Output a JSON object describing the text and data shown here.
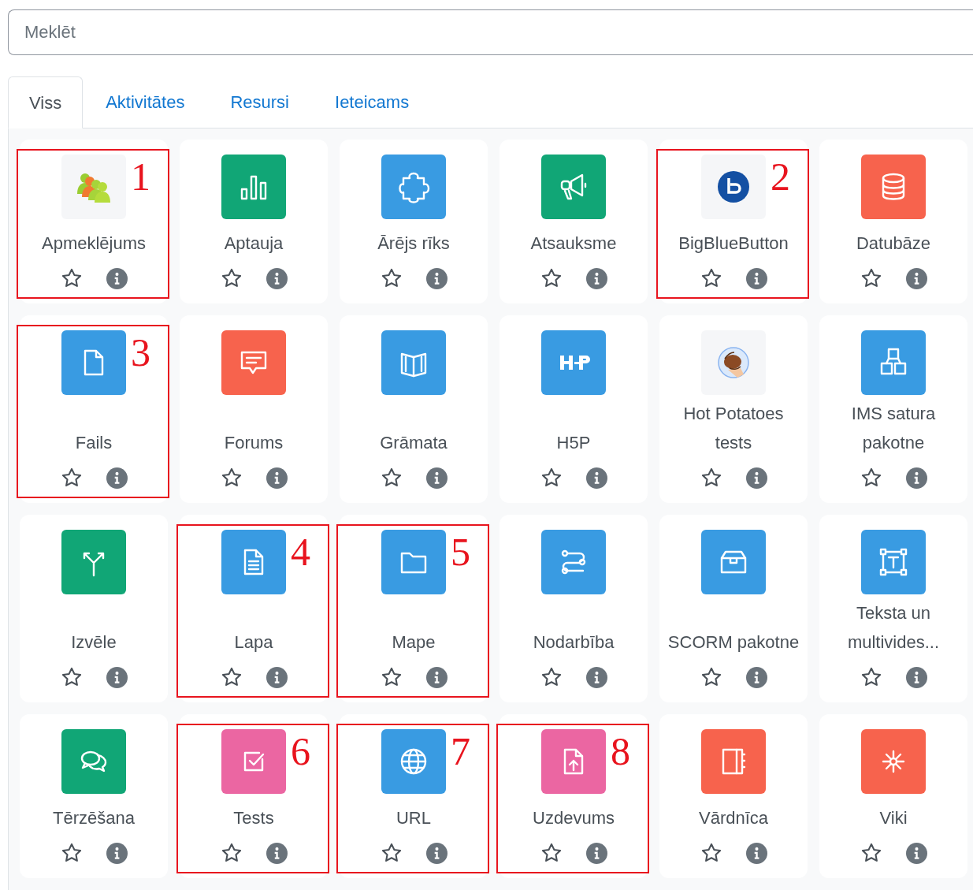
{
  "search": {
    "placeholder": "Meklēt"
  },
  "tabs": [
    {
      "label": "Viss",
      "selected": true
    },
    {
      "label": "Aktivitātes",
      "selected": false
    },
    {
      "label": "Resursi",
      "selected": false
    },
    {
      "label": "Ieteicams",
      "selected": false
    }
  ],
  "modules": [
    {
      "label": "Apmeklējums",
      "kind": "attendance",
      "color": "#f5f6f8",
      "callout": "1"
    },
    {
      "label": "Aptauja",
      "kind": "chart",
      "color": "#11a676"
    },
    {
      "label": "Ārējs rīks",
      "kind": "puzzle",
      "color": "#399be2"
    },
    {
      "label": "Atsauksme",
      "kind": "megaphone",
      "color": "#11a676"
    },
    {
      "label": "BigBlueButton",
      "kind": "bbb",
      "color": "#f5f6f8",
      "callout": "2"
    },
    {
      "label": "Datubāze",
      "kind": "database",
      "color": "#f7634d"
    },
    {
      "label": "Fails",
      "kind": "file",
      "color": "#399be2",
      "callout": "3"
    },
    {
      "label": "Forums",
      "kind": "forum",
      "color": "#f7634d"
    },
    {
      "label": "Grāmata",
      "kind": "book",
      "color": "#399be2"
    },
    {
      "label": "H5P",
      "kind": "h5p",
      "color": "#399be2"
    },
    {
      "label": "Hot Potatoes tests",
      "kind": "hotpot",
      "color": "#f5f6f8"
    },
    {
      "label": "IMS satura pakotne",
      "kind": "boxes",
      "color": "#399be2"
    },
    {
      "label": "Izvēle",
      "kind": "choice",
      "color": "#11a676"
    },
    {
      "label": "Lapa",
      "kind": "page",
      "color": "#399be2",
      "callout": "4"
    },
    {
      "label": "Mape",
      "kind": "folder",
      "color": "#399be2",
      "callout": "5"
    },
    {
      "label": "Nodarbība",
      "kind": "workshop",
      "color": "#399be2"
    },
    {
      "label": "SCORM pakotne",
      "kind": "scorm",
      "color": "#399be2"
    },
    {
      "label": "Teksta un multivides...",
      "kind": "textframe",
      "color": "#399be2"
    },
    {
      "label": "Tērzēšana",
      "kind": "chat",
      "color": "#11a676"
    },
    {
      "label": "Tests",
      "kind": "quiz",
      "color": "#eb66a2",
      "callout": "6"
    },
    {
      "label": "URL",
      "kind": "globe",
      "color": "#399be2",
      "callout": "7"
    },
    {
      "label": "Uzdevums",
      "kind": "assign",
      "color": "#eb66a2",
      "callout": "8"
    },
    {
      "label": "Vārdnīca",
      "kind": "glossary",
      "color": "#f7634d"
    },
    {
      "label": "Viki",
      "kind": "wiki",
      "color": "#f7634d"
    }
  ]
}
